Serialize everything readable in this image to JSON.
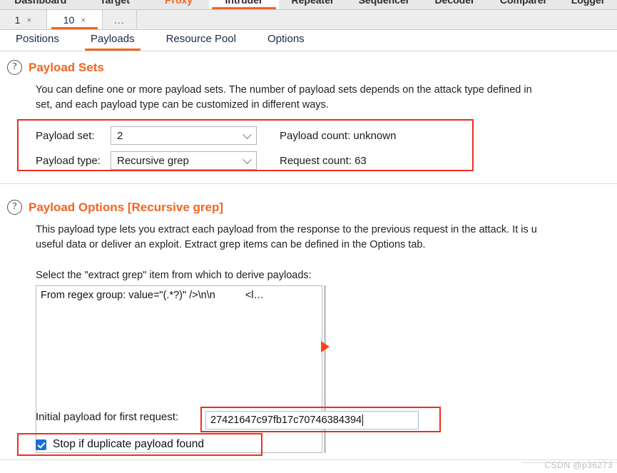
{
  "product_tabs": [
    {
      "label": "Dashboard",
      "state": "normal"
    },
    {
      "label": "Target",
      "state": "normal"
    },
    {
      "label": "Proxy",
      "state": "highlight"
    },
    {
      "label": "Intruder",
      "state": "active"
    },
    {
      "label": "Repeater",
      "state": "normal"
    },
    {
      "label": "Sequencer",
      "state": "normal"
    },
    {
      "label": "Decoder",
      "state": "normal"
    },
    {
      "label": "Comparer",
      "state": "normal"
    },
    {
      "label": "Logger",
      "state": "normal"
    }
  ],
  "attack_tabs": [
    {
      "label": "1",
      "close": "×",
      "active": false
    },
    {
      "label": "10",
      "close": "×",
      "active": true
    }
  ],
  "attack_tabs_more": "...",
  "sub_tabs": [
    {
      "label": "Positions",
      "active": false
    },
    {
      "label": "Payloads",
      "active": true
    },
    {
      "label": "Resource Pool",
      "active": false
    },
    {
      "label": "Options",
      "active": false
    }
  ],
  "payload_sets": {
    "help_glyph": "?",
    "title": "Payload Sets",
    "desc_line1": "You can define one or more payload sets. The number of payload sets depends on the attack type defined in",
    "desc_line2": "set, and each payload type can be customized in different ways.",
    "payload_set_label": "Payload set:",
    "payload_set_value": "2",
    "payload_type_label": "Payload type:",
    "payload_type_value": "Recursive grep",
    "payload_count": "Payload count: unknown",
    "request_count": "Request count: 63"
  },
  "payload_options": {
    "help_glyph": "?",
    "title": "Payload Options [Recursive grep]",
    "desc_line1": "This payload type lets you extract each payload from the response to the previous request in the attack. It is u",
    "desc_line2": "useful data or deliver an exploit. Extract grep items can be defined in the Options tab.",
    "select_prompt": "Select the \"extract grep\" item from which to derive payloads:",
    "list_items": [
      {
        "main": "From regex group:  value=\"(.*?)\" />\\n\\n",
        "tail": "<l…"
      }
    ],
    "initial_payload_label": "Initial payload for first request:",
    "initial_payload_value": "27421647c97fb17c70746384394",
    "stop_duplicate_label": "Stop if duplicate payload found",
    "stop_duplicate_checked": true
  },
  "watermark": "CSDN @p36273",
  "colors": {
    "accent": "#f26522",
    "annotation": "#ef2d20",
    "checkbox": "#1c6fd0",
    "triangle": "#fa4616"
  }
}
